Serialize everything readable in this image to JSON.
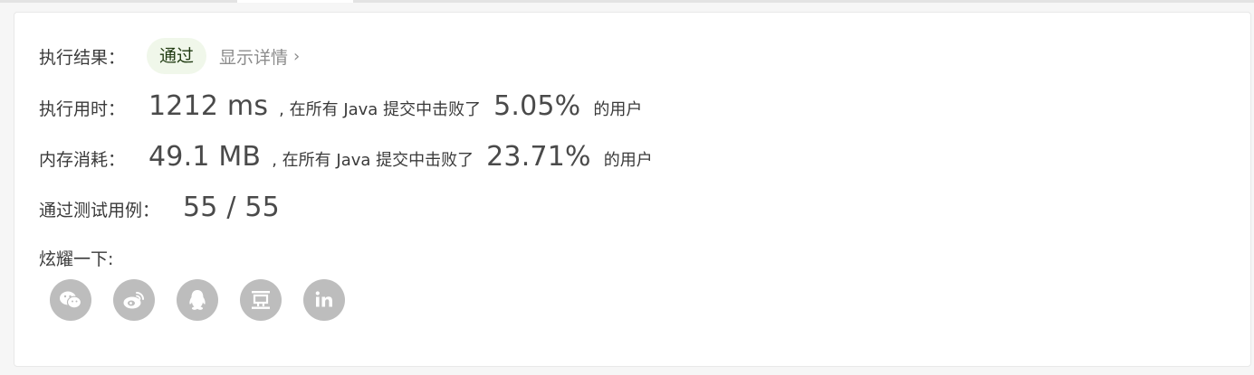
{
  "result": {
    "label": "执行结果：",
    "status": "通过",
    "detail_link": "显示详情",
    "detail_chevron": "›"
  },
  "runtime": {
    "label": "执行用时：",
    "value": "1212 ms",
    "mid_text": ", 在所有 Java 提交中击败了",
    "percent": "5.05%",
    "suffix": "的用户"
  },
  "memory": {
    "label": "内存消耗：",
    "value": "49.1 MB",
    "mid_text": ", 在所有 Java 提交中击败了",
    "percent": "23.71%",
    "suffix": "的用户"
  },
  "testcases": {
    "label": "通过测试用例：",
    "value": "55 / 55"
  },
  "share": {
    "label": "炫耀一下:",
    "buttons": [
      {
        "icon": "wechat-icon"
      },
      {
        "icon": "weibo-icon"
      },
      {
        "icon": "qq-icon"
      },
      {
        "icon": "douban-icon"
      },
      {
        "icon": "linkedin-icon"
      }
    ]
  },
  "colors": {
    "badge_bg": "#f0f7ea",
    "icon_bg": "#bdbdbd"
  }
}
